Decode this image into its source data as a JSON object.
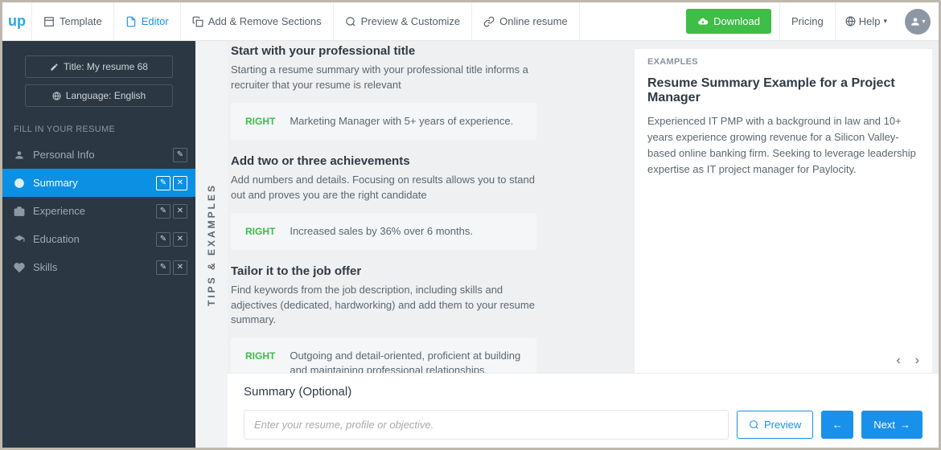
{
  "topbar": {
    "logo": "up",
    "tabs": {
      "template": "Template",
      "editor": "Editor",
      "sections": "Add & Remove Sections",
      "preview": "Preview & Customize",
      "online": "Online resume"
    },
    "download": "Download",
    "pricing": "Pricing",
    "help": "Help"
  },
  "sidebar": {
    "title_pill": "Title: My resume 68",
    "lang_pill": "Language: English",
    "section_header": "FILL IN YOUR RESUME",
    "items": {
      "personal": "Personal Info",
      "summary": "Summary",
      "experience": "Experience",
      "education": "Education",
      "skills": "Skills"
    }
  },
  "trail_label": "TIPS & EXAMPLES",
  "tips": {
    "t1": {
      "title": "Start with your professional title",
      "body": "Starting a resume summary with your professional title informs a recruiter that your resume is relevant",
      "tag": "RIGHT",
      "example": "Marketing Manager with 5+ years of experience."
    },
    "t2": {
      "title": "Add two or three achievements",
      "body": "Add numbers and details. Focusing on results allows you to stand out and proves you are the right candidate",
      "tag": "RIGHT",
      "example": "Increased sales by 36% over 6 months."
    },
    "t3": {
      "title": "Tailor it to the job offer",
      "body": "Find keywords from the job description, including skills and adjectives (dedicated, hardworking) and add them to your resume summary.",
      "tag": "RIGHT",
      "example": "Outgoing and detail-oriented, proficient at building and maintaining professional relationships."
    }
  },
  "examples": {
    "label": "EXAMPLES",
    "title": "Resume Summary Example for a Project Manager",
    "body": "Experienced IT PMP with a background in law and 10+ years experience growing revenue for a Silicon Valley-based online banking firm. Seeking to leverage leadership expertise as IT project manager for Paylocity."
  },
  "footer": {
    "heading": "Summary (Optional)",
    "placeholder": "Enter your resume, profile or objective.",
    "preview": "Preview",
    "next": "Next"
  }
}
